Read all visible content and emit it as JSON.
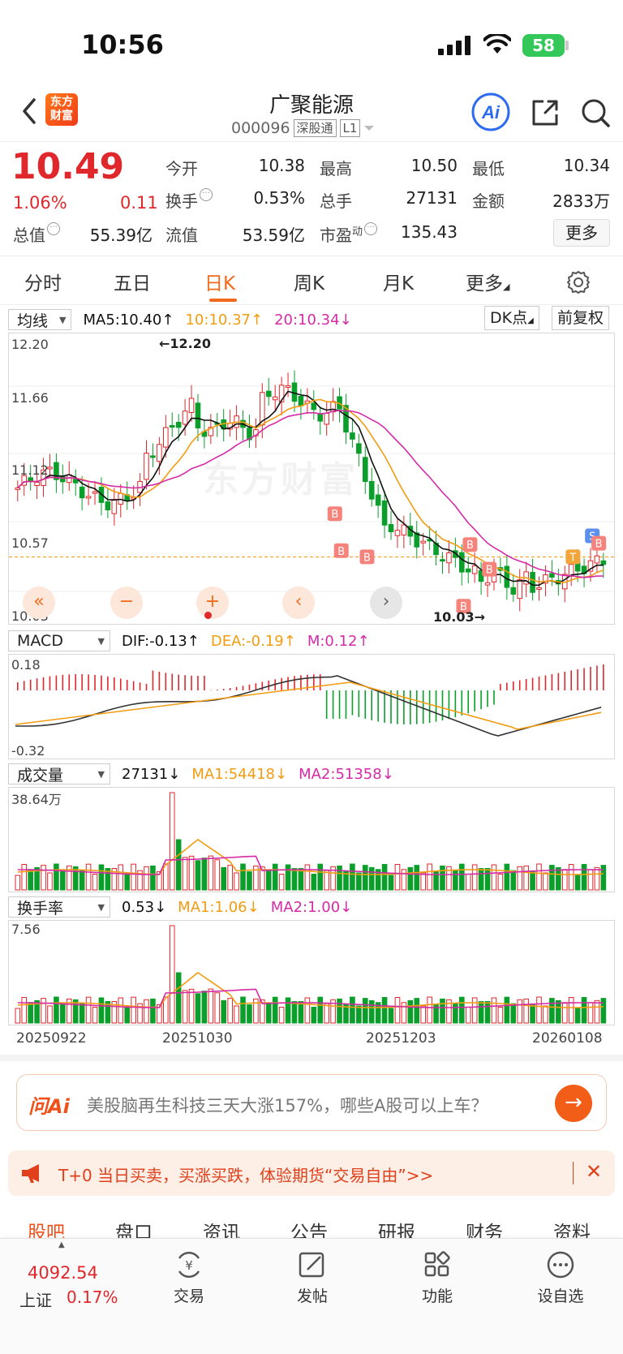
{
  "status_bar": {
    "time": "10:56",
    "battery": "58"
  },
  "header": {
    "logo_text": "东方财富",
    "stock_name": "广聚能源",
    "stock_code": "000096",
    "tag_connect": "深股通",
    "tag_level": "L1"
  },
  "quote": {
    "price": "10.49",
    "change_pct": "1.06%",
    "change": "0.11",
    "open_label": "今开",
    "open": "10.38",
    "high_label": "最高",
    "high": "10.50",
    "low_label": "最低",
    "low": "10.34",
    "turnover_label": "换手",
    "turnover": "0.53%",
    "volume_label": "总手",
    "volume": "27131",
    "amount_label": "金额",
    "amount": "2833万",
    "mktcap_label": "总值",
    "mktcap": "55.39亿",
    "float_label": "流值",
    "float_cap": "53.59亿",
    "pe_label": "市盈",
    "pe_sup": "动",
    "pe": "135.43",
    "more_label": "更多"
  },
  "tabs": [
    "分时",
    "五日",
    "日K",
    "周K",
    "月K",
    "更多"
  ],
  "kline": {
    "ma_select": "均线",
    "ma5": "MA5:10.40",
    "ma10": "10:10.37",
    "ma20": "20:10.34",
    "dk_label": "DK点",
    "adjust_label": "前复权",
    "axis": [
      "12.20",
      "11.66",
      "11.12",
      "10.57",
      "10.03"
    ],
    "high_marker": "12.20",
    "low_marker": "10.03",
    "watermark": "东方财富",
    "signal_b": "B",
    "signal_s": "S",
    "signal_t": "T"
  },
  "macd": {
    "select": "MACD",
    "dif": "DIF:-0.13",
    "dea": "DEA:-0.19",
    "m": "M:0.12",
    "axis_top": "0.18",
    "axis_bottom": "-0.32"
  },
  "volume": {
    "select": "成交量",
    "value": "27131",
    "ma1": "MA1:54418",
    "ma2": "MA2:51358",
    "axis_top": "38.64万"
  },
  "turnover": {
    "select": "换手率",
    "value": "0.53",
    "ma1": "MA1:1.06",
    "ma2": "MA2:1.00",
    "axis_top": "7.56"
  },
  "dates": [
    "20250922",
    "20251030",
    "20251203",
    "20260108"
  ],
  "ai_bar": {
    "logo": "问Ai",
    "text": "美股脑再生科技三天大涨157%，哪些A股可以上车？"
  },
  "promo": {
    "text": "T+0 当日买卖，买涨买跌，体验期货“交易自由”>>"
  },
  "sub_tabs": [
    "股吧",
    "盘口",
    "资讯",
    "公告",
    "研报",
    "财务",
    "资料"
  ],
  "bottom_nav": {
    "index_value": "4092.54",
    "index_name": "上证",
    "index_pct": "0.17%",
    "items": [
      "交易",
      "发帖",
      "功能",
      "设自选"
    ]
  },
  "colors": {
    "up": "#e0272b",
    "down": "#0a9e2a",
    "accent": "#f26a1b",
    "ma5": "#111111",
    "ma10": "#f39c12",
    "ma20": "#d62ba6"
  }
}
